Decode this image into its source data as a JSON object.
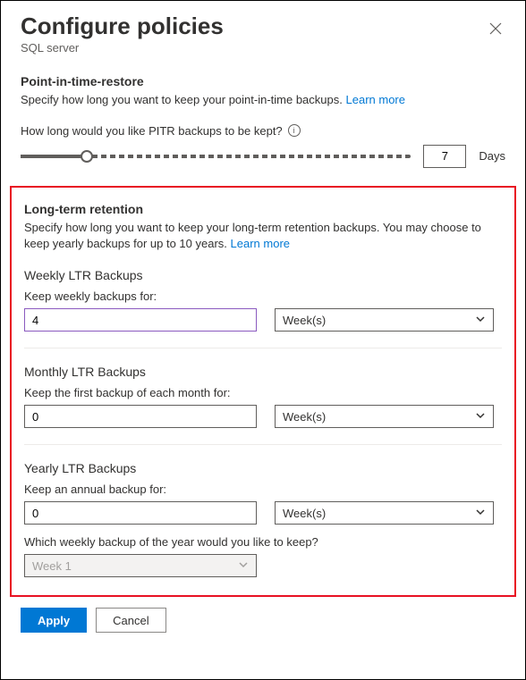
{
  "header": {
    "title": "Configure policies",
    "subtitle": "SQL server"
  },
  "pitr": {
    "section_title": "Point-in-time-restore",
    "description": "Specify how long you want to keep your point-in-time backups.",
    "learn_more": "Learn more",
    "question": "How long would you like PITR backups to be kept?",
    "value": "7",
    "unit": "Days"
  },
  "ltr": {
    "section_title": "Long-term retention",
    "description": "Specify how long you want to keep your long-term retention backups. You may choose to keep yearly backups for up to 10 years.",
    "learn_more": "Learn more",
    "weekly": {
      "heading": "Weekly LTR Backups",
      "label": "Keep weekly backups for:",
      "value": "4",
      "unit": "Week(s)"
    },
    "monthly": {
      "heading": "Monthly LTR Backups",
      "label": "Keep the first backup of each month for:",
      "value": "0",
      "unit": "Week(s)"
    },
    "yearly": {
      "heading": "Yearly LTR Backups",
      "label": "Keep an annual backup for:",
      "value": "0",
      "unit": "Week(s)",
      "week_question": "Which weekly backup of the year would you like to keep?",
      "week_value": "Week 1"
    }
  },
  "footer": {
    "apply": "Apply",
    "cancel": "Cancel"
  }
}
